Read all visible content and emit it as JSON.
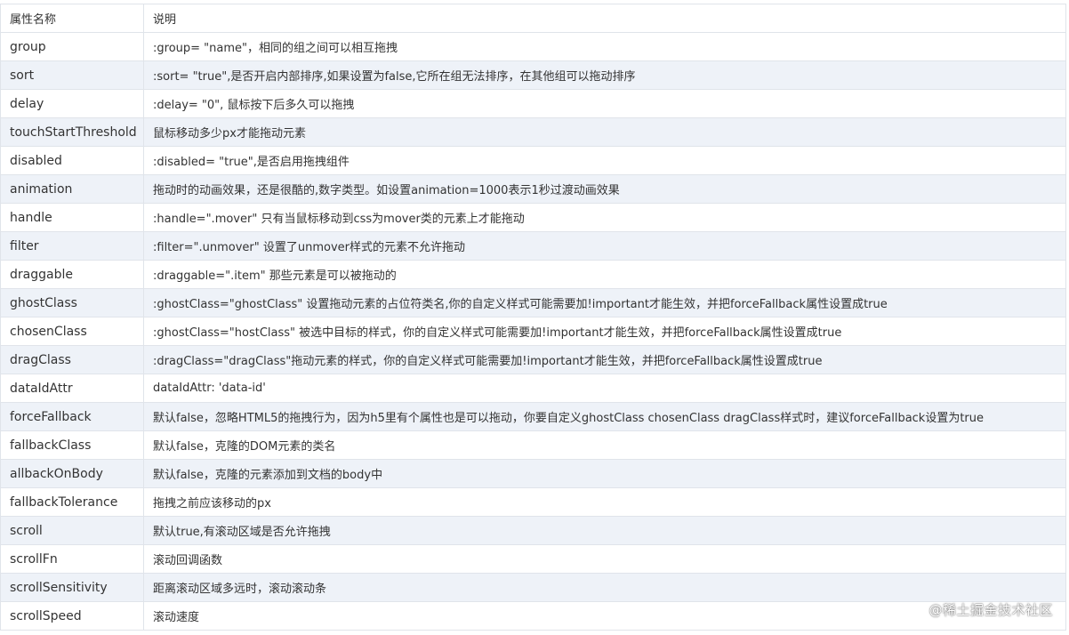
{
  "table": {
    "headers": [
      "属性名称",
      "说明"
    ],
    "rows": [
      [
        "group",
        ":group= \"name\"，相同的组之间可以相互拖拽"
      ],
      [
        "sort",
        ":sort= \"true\",是否开启内部排序,如果设置为false,它所在组无法排序，在其他组可以拖动排序"
      ],
      [
        "delay",
        ":delay= \"0\", 鼠标按下后多久可以拖拽"
      ],
      [
        "touchStartThreshold",
        "鼠标移动多少px才能拖动元素"
      ],
      [
        "disabled",
        ":disabled= \"true\",是否启用拖拽组件"
      ],
      [
        "animation",
        "拖动时的动画效果，还是很酷的,数字类型。如设置animation=1000表示1秒过渡动画效果"
      ],
      [
        "handle",
        ":handle=\".mover\" 只有当鼠标移动到css为mover类的元素上才能拖动"
      ],
      [
        "filter",
        ":filter=\".unmover\" 设置了unmover样式的元素不允许拖动"
      ],
      [
        "draggable",
        ":draggable=\".item\" 那些元素是可以被拖动的"
      ],
      [
        "ghostClass",
        ":ghostClass=\"ghostClass\" 设置拖动元素的占位符类名,你的自定义样式可能需要加!important才能生效，并把forceFallback属性设置成true"
      ],
      [
        "chosenClass",
        ":ghostClass=\"hostClass\" 被选中目标的样式，你的自定义样式可能需要加!important才能生效，并把forceFallback属性设置成true"
      ],
      [
        "dragClass",
        ":dragClass=\"dragClass\"拖动元素的样式，你的自定义样式可能需要加!important才能生效，并把forceFallback属性设置成true"
      ],
      [
        "dataIdAttr",
        "dataIdAttr: 'data-id'"
      ],
      [
        "forceFallback",
        "默认false，忽略HTML5的拖拽行为，因为h5里有个属性也是可以拖动，你要自定义ghostClass chosenClass dragClass样式时，建议forceFallback设置为true"
      ],
      [
        "fallbackClass",
        "默认false，克隆的DOM元素的类名"
      ],
      [
        "allbackOnBody",
        "默认false，克隆的元素添加到文档的body中"
      ],
      [
        "fallbackTolerance",
        "拖拽之前应该移动的px"
      ],
      [
        "scroll",
        "默认true,有滚动区域是否允许拖拽"
      ],
      [
        "scrollFn",
        "滚动回调函数"
      ],
      [
        "scrollSensitivity",
        "距离滚动区域多远时，滚动滚动条"
      ],
      [
        "scrollSpeed",
        "滚动速度"
      ]
    ]
  },
  "watermark": "@稀土掘金技术社区",
  "colors": {
    "row_stripe": "#eef2f8",
    "border": "#e0e4ea",
    "text": "#333333"
  }
}
